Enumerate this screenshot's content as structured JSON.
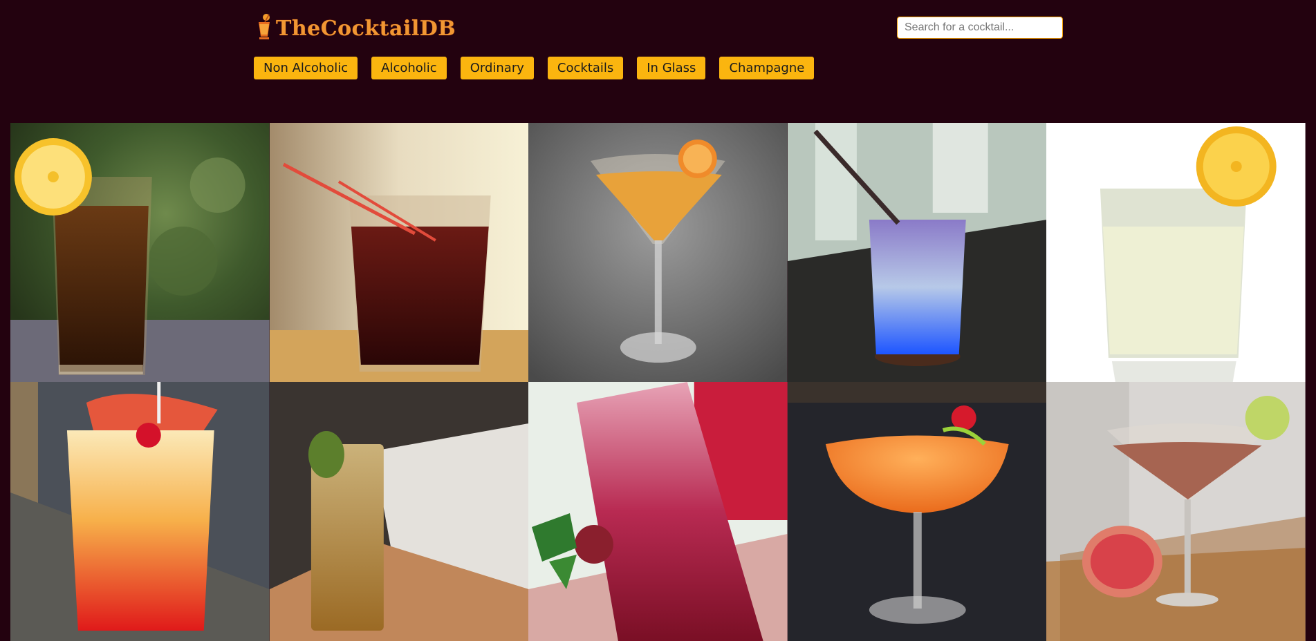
{
  "brand": {
    "name": "TheCocktailDB",
    "logo_icon": "cocktail-glass-icon",
    "accent_color": "#f19733"
  },
  "search": {
    "placeholder": "Search for a cocktail...",
    "value": ""
  },
  "nav": {
    "items": [
      {
        "label": "Non Alcoholic"
      },
      {
        "label": "Alcoholic"
      },
      {
        "label": "Ordinary"
      },
      {
        "label": "Cocktails"
      },
      {
        "label": "In Glass"
      },
      {
        "label": "Champagne"
      }
    ],
    "button_color": "#fbb50f"
  },
  "page": {
    "background_color": "#23020f"
  },
  "drinks": [
    {
      "icon": "highball-cola-lemon-image"
    },
    {
      "icon": "rocks-dark-red-straw-image"
    },
    {
      "icon": "martini-orange-garnish-image"
    },
    {
      "icon": "blue-purple-layered-straw-image"
    },
    {
      "icon": "rocks-clear-lemon-image"
    },
    {
      "icon": "sunrise-grapefruit-cherry-image"
    },
    {
      "icon": "tall-amber-lime-image"
    },
    {
      "icon": "red-frozen-strawberry-image"
    },
    {
      "icon": "coupe-orange-cherry-image"
    },
    {
      "icon": "martini-pink-grapefruit-image"
    }
  ]
}
